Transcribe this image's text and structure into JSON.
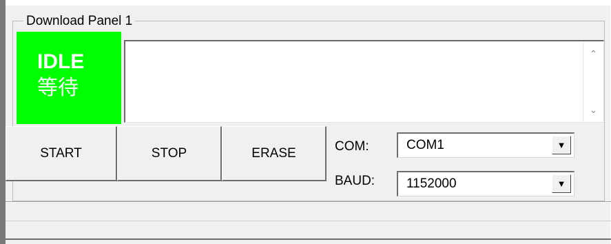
{
  "panel": {
    "title": "Download Panel 1",
    "status": {
      "label_en": "IDLE",
      "label_zh": "等待",
      "color": "#00ff00"
    },
    "log": {
      "text": "",
      "scroll_up_icon": "chevron-up-icon",
      "scroll_down_icon": "chevron-down-icon"
    },
    "buttons": {
      "start": "START",
      "stop": "STOP",
      "erase": "ERASE"
    },
    "com": {
      "label": "COM:",
      "value": "COM1"
    },
    "baud": {
      "label": "BAUD:",
      "value": "1152000"
    }
  }
}
